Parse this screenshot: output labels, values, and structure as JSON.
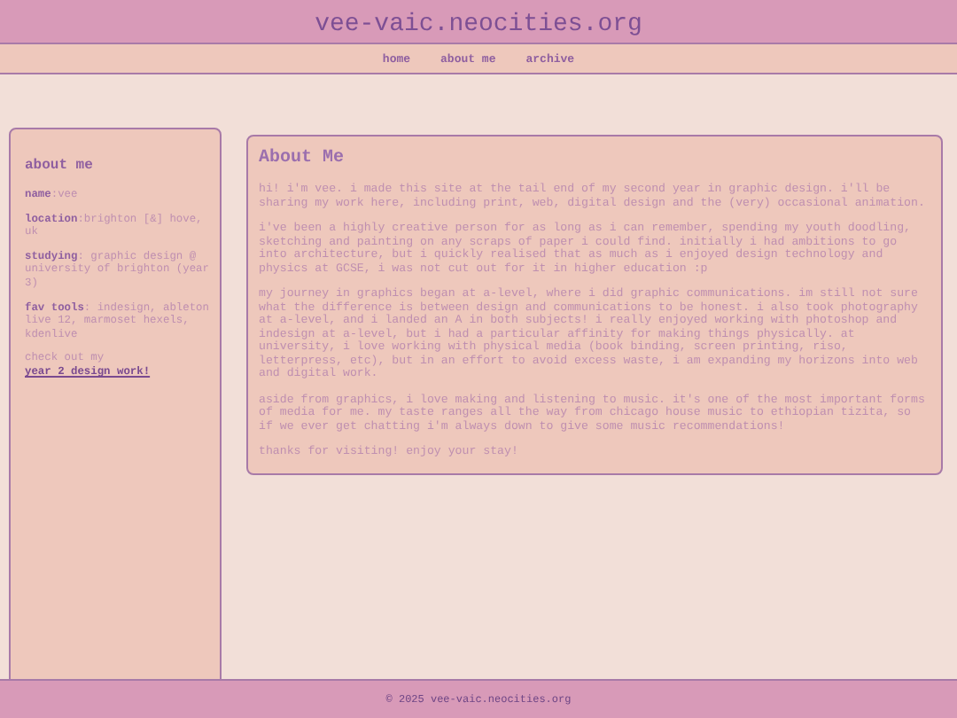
{
  "site_title": "vee-vaic.neocities.org",
  "nav": [
    "home",
    "about me",
    "archive"
  ],
  "sidebar": {
    "heading": "about me",
    "fields": [
      "**name**:vee",
      "**location**:brighton [&] hove, uk",
      "**studying**: graphic design @ university of brighton (year 3)",
      "**fav tools**: indesign, ableton live 12, marmoset hexels, kdenlive"
    ],
    "note": "check out my",
    "link": "year 2 design work!"
  },
  "content": {
    "heading": "About Me",
    "paragraphs": [
      "hi! i'm vee. i made this site at the tail end of my second year in graphic design. i'll be sharing my work here, including print, web, digital design and the (very) occasional animation.",
      "i've been a highly creative person for as long as i can remember, spending my youth doodling, sketching and painting on any scraps of paper i could find. initially i had ambitions to go into architecture, but i quickly realised that as much as i enjoyed design technology and physics at GCSE, i was not cut out for it in higher education :p",
      "my journey in graphics began at a-level, where i did graphic communications. im still not sure what the difference is between design and communications to be honest. i also took photography at a-level, and i landed an A in both subjects! i really enjoyed working with photoshop and indesign at a-level, but i had a particular affinity for making things physically. at university, i love working with physical media (book binding, screen printing, riso, letterpress, etc), but in an effort to avoid excess waste, i am expanding my horizons into web and digital work.",
      "aside from graphics, i love making and listening to music. it's one of the most important forms of media for me. my taste ranges all the way from chicago house music to ethiopian tizita, so if we ever get chatting i'm always down to give some music recommendations!",
      "thanks for visiting! enjoy your stay!"
    ]
  },
  "footer": "© 2025 vee-vaic.neocities.org"
}
